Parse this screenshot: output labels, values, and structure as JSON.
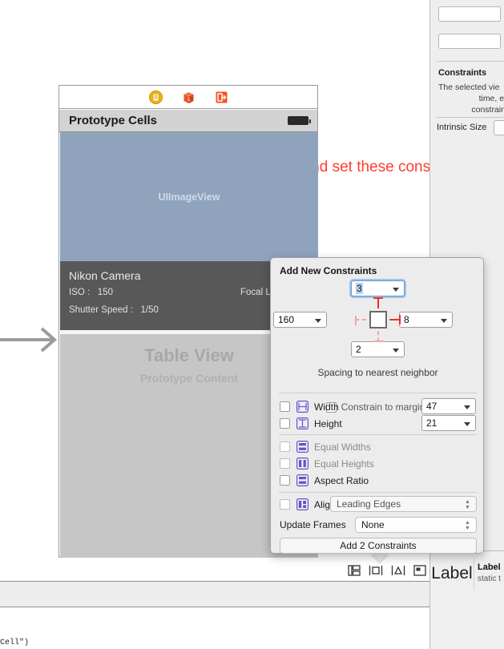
{
  "inspector": {
    "section_title": "Constraints",
    "description_lines": [
      "The selected vie",
      "time, explici",
      "constraints w"
    ],
    "intrinsic_size_label": "Intrinsic Size"
  },
  "library": {
    "preview_text": "Label",
    "title": "Label",
    "subtitle": "static t",
    "doc_icon": "document-icon"
  },
  "canvas": {
    "entry_arrow": "scene-entry-arrow",
    "dock_icons": [
      {
        "name": "view-controller-icon",
        "color": "#f0b400"
      },
      {
        "name": "first-responder-icon",
        "color": "#e8562a"
      },
      {
        "name": "exit-icon",
        "color": "#f2541f"
      }
    ],
    "nav_bar": {
      "title": "Prototype Cells",
      "battery": "battery-icon"
    },
    "image_cell": {
      "label": "UIImageView",
      "fill": "#8fa3bd"
    },
    "info_cell": {
      "title": "Nikon Camera",
      "iso_label": "ISO :",
      "iso_value": "150",
      "focal_label": "Focal Len",
      "shutter_label": "Shutter Speed :",
      "shutter_value": "1/50",
      "fill": "#585858"
    },
    "table_view": {
      "title": "Table View",
      "subtitle": "Prototype Content"
    },
    "annotation": "select lens label and set these constraints",
    "annotation_color": "#ff3b30",
    "code_snippet": "Cell\")"
  },
  "autolayout_toolbar": {
    "buttons": [
      {
        "name": "stack-button",
        "label": "Stack"
      },
      {
        "name": "align-button",
        "label": "Align"
      },
      {
        "name": "pin-button",
        "label": "Pin"
      },
      {
        "name": "resolve-issues-button",
        "label": "Resolve Auto Layout Issues"
      }
    ]
  },
  "popover": {
    "title": "Add New Constraints",
    "spacing": {
      "top": "3",
      "left": "160",
      "right": "8",
      "bottom": "2",
      "top_active": true,
      "right_active": true,
      "left_active": false,
      "bottom_active": false,
      "caption": "Spacing to nearest neighbor",
      "constrain_to_margins_label": "Constrain to margins",
      "constrain_to_margins_checked": false
    },
    "constraint_rows": [
      {
        "name": "width",
        "icon": "width-icon",
        "label": "Width",
        "checked": false,
        "value": "47",
        "has_value": true,
        "dim": false
      },
      {
        "name": "height",
        "icon": "height-icon",
        "label": "Height",
        "checked": false,
        "value": "21",
        "has_value": true,
        "dim": false
      },
      {
        "name": "equal-widths",
        "icon": "equal-widths-icon",
        "label": "Equal Widths",
        "checked": false,
        "value": "",
        "has_value": false,
        "dim": true
      },
      {
        "name": "equal-heights",
        "icon": "equal-heights-icon",
        "label": "Equal Heights",
        "checked": false,
        "value": "",
        "has_value": false,
        "dim": true
      },
      {
        "name": "aspect-ratio",
        "icon": "aspect-ratio-icon",
        "label": "Aspect Ratio",
        "checked": false,
        "value": "",
        "has_value": false,
        "dim": false
      }
    ],
    "align": {
      "icon": "align-icon",
      "label": "Align",
      "checked": false,
      "value": "Leading Edges"
    },
    "update_frames": {
      "label": "Update Frames",
      "value": "None"
    },
    "submit_label": "Add 2 Constraints"
  }
}
